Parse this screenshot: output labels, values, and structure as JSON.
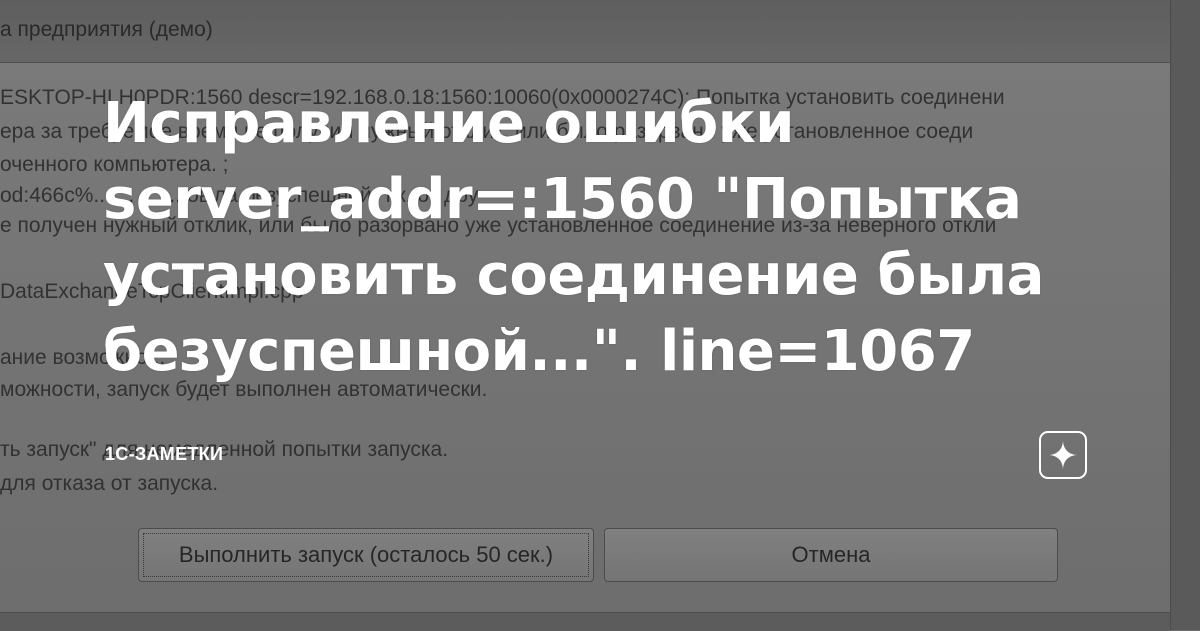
{
  "background_dialog": {
    "title": "а предприятия (демо)",
    "lines": [
      "ESKTOP-HLH0PDR:1560 descr=192.168.0.18:1560:10060(0x0000274C): Попытка установить соединени",
      "ера за требуемое время не получил нужный отклик, или было разорвано уже установленное соеди",
      "оченного компьютера. ;",
      "od:466c%...          ...        ...              ...  была безуспешной, т.к. от дру",
      "е получен нужный отклик, или было разорвано уже установленное соединение из-за неверного откли",
      "DataExchangeTcpClientImpl.cpp",
      "ание возможно...",
      "можности, запуск будет выполнен автоматически.",
      "ть запуск\" для немедленной попытки запуска.",
      "для отказа от запуска."
    ],
    "run_button_label": "Выполнить запуск (осталось 50 сек.)",
    "cancel_button_label": "Отмена"
  },
  "article": {
    "headline_lines": [
      "Исправление ошибки",
      "server_addr=:1560 \"Попытка",
      "установить соединение была",
      "безуспешной...\". line=1067"
    ],
    "channel": "1С-ЗАМЕТКИ",
    "logo_icon": "zen-star-icon",
    "text_color": "#ffffff",
    "overlay_color": "#6e6e6e"
  }
}
